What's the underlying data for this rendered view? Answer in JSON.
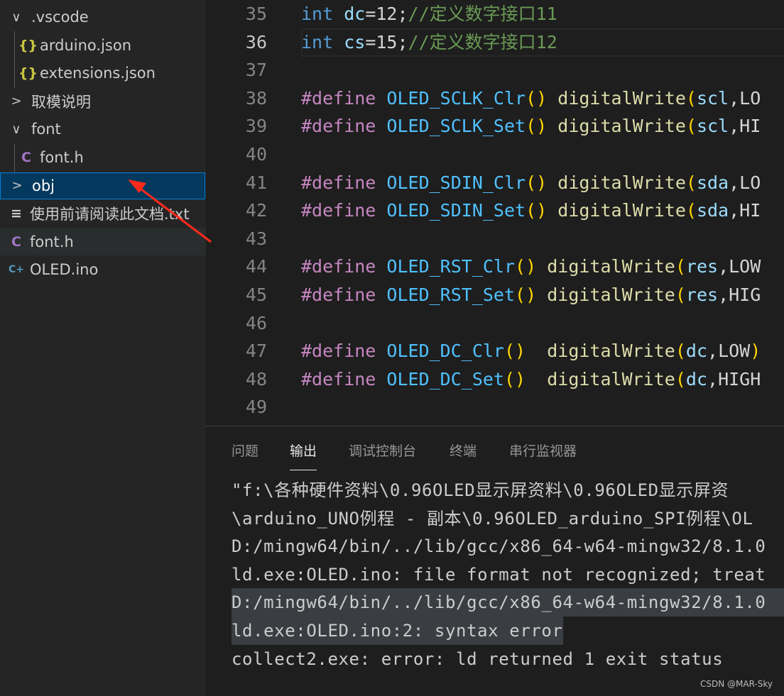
{
  "sidebar": {
    "items": [
      {
        "label": ".vscode",
        "icon": "chevron-down-icon",
        "twisty": "∨",
        "depth": 0
      },
      {
        "label": "arduino.json",
        "icon": "json-icon",
        "glyph": "{}",
        "color": "#cbcb41",
        "depth": 1
      },
      {
        "label": "extensions.json",
        "icon": "json-icon",
        "glyph": "{}",
        "color": "#cbcb41",
        "depth": 1
      },
      {
        "label": "取模说明",
        "icon": "chevron-right-icon",
        "twisty": ">",
        "depth": 0
      },
      {
        "label": "font",
        "icon": "chevron-down-icon",
        "twisty": "∨",
        "depth": 0
      },
      {
        "label": "font.h",
        "icon": "c-file-icon",
        "glyph": "C",
        "color": "#a074c4",
        "depth": 1
      },
      {
        "label": "obj",
        "icon": "chevron-right-icon",
        "twisty": ">",
        "depth": 0,
        "selected": true
      },
      {
        "label": "使用前请阅读此文档.txt",
        "icon": "text-file-icon",
        "glyph": "≡",
        "color": "#cccccc",
        "depth": 0
      },
      {
        "label": "font.h",
        "icon": "c-file-icon",
        "glyph": "C",
        "color": "#a074c4",
        "depth": 0,
        "hover": true
      },
      {
        "label": "OLED.ino",
        "icon": "cpp-file-icon",
        "glyph": "C+",
        "color": "#519aba",
        "depth": 0
      }
    ]
  },
  "editor": {
    "current_line": 36,
    "lines": [
      {
        "n": "35",
        "t": [
          [
            "kw",
            "int"
          ],
          [
            "tx",
            " "
          ],
          [
            "var",
            "dc"
          ],
          [
            "tx",
            "=12;"
          ],
          [
            "cm",
            "//定义数字接口11"
          ]
        ]
      },
      {
        "n": "36",
        "t": [
          [
            "kw",
            "int"
          ],
          [
            "tx",
            " "
          ],
          [
            "var",
            "cs"
          ],
          [
            "tx",
            "=15;"
          ],
          [
            "cm",
            "//定义数字接口12"
          ]
        ]
      },
      {
        "n": "37",
        "t": []
      },
      {
        "n": "38",
        "t": [
          [
            "pp",
            "#define"
          ],
          [
            "tx",
            " "
          ],
          [
            "mac",
            "OLED_SCLK_Clr"
          ],
          [
            "br",
            "()"
          ],
          [
            "tx",
            " "
          ],
          [
            "fn",
            "digitalWrite"
          ],
          [
            "br",
            "("
          ],
          [
            "var",
            "scl"
          ],
          [
            "tx",
            ",LO"
          ]
        ]
      },
      {
        "n": "39",
        "t": [
          [
            "pp",
            "#define"
          ],
          [
            "tx",
            " "
          ],
          [
            "mac",
            "OLED_SCLK_Set"
          ],
          [
            "br",
            "()"
          ],
          [
            "tx",
            " "
          ],
          [
            "fn",
            "digitalWrite"
          ],
          [
            "br",
            "("
          ],
          [
            "var",
            "scl"
          ],
          [
            "tx",
            ",HI"
          ]
        ]
      },
      {
        "n": "40",
        "t": []
      },
      {
        "n": "41",
        "t": [
          [
            "pp",
            "#define"
          ],
          [
            "tx",
            " "
          ],
          [
            "mac",
            "OLED_SDIN_Clr"
          ],
          [
            "br",
            "()"
          ],
          [
            "tx",
            " "
          ],
          [
            "fn",
            "digitalWrite"
          ],
          [
            "br",
            "("
          ],
          [
            "var",
            "sda"
          ],
          [
            "tx",
            ",LO"
          ]
        ]
      },
      {
        "n": "42",
        "t": [
          [
            "pp",
            "#define"
          ],
          [
            "tx",
            " "
          ],
          [
            "mac",
            "OLED_SDIN_Set"
          ],
          [
            "br",
            "()"
          ],
          [
            "tx",
            " "
          ],
          [
            "fn",
            "digitalWrite"
          ],
          [
            "br",
            "("
          ],
          [
            "var",
            "sda"
          ],
          [
            "tx",
            ",HI"
          ]
        ]
      },
      {
        "n": "43",
        "t": []
      },
      {
        "n": "44",
        "t": [
          [
            "pp",
            "#define"
          ],
          [
            "tx",
            " "
          ],
          [
            "mac",
            "OLED_RST_Clr"
          ],
          [
            "br",
            "()"
          ],
          [
            "tx",
            " "
          ],
          [
            "fn",
            "digitalWrite"
          ],
          [
            "br",
            "("
          ],
          [
            "var",
            "res"
          ],
          [
            "tx",
            ",LOW"
          ]
        ]
      },
      {
        "n": "45",
        "t": [
          [
            "pp",
            "#define"
          ],
          [
            "tx",
            " "
          ],
          [
            "mac",
            "OLED_RST_Set"
          ],
          [
            "br",
            "()"
          ],
          [
            "tx",
            " "
          ],
          [
            "fn",
            "digitalWrite"
          ],
          [
            "br",
            "("
          ],
          [
            "var",
            "res"
          ],
          [
            "tx",
            ",HIG"
          ]
        ]
      },
      {
        "n": "46",
        "t": []
      },
      {
        "n": "47",
        "t": [
          [
            "pp",
            "#define"
          ],
          [
            "tx",
            " "
          ],
          [
            "mac",
            "OLED_DC_Clr"
          ],
          [
            "br",
            "()"
          ],
          [
            "tx",
            "  "
          ],
          [
            "fn",
            "digitalWrite"
          ],
          [
            "br",
            "("
          ],
          [
            "var",
            "dc"
          ],
          [
            "tx",
            ",LOW"
          ],
          [
            "br",
            ")"
          ]
        ]
      },
      {
        "n": "48",
        "t": [
          [
            "pp",
            "#define"
          ],
          [
            "tx",
            " "
          ],
          [
            "mac",
            "OLED_DC_Set"
          ],
          [
            "br",
            "()"
          ],
          [
            "tx",
            "  "
          ],
          [
            "fn",
            "digitalWrite"
          ],
          [
            "br",
            "("
          ],
          [
            "var",
            "dc"
          ],
          [
            "tx",
            ",HIGH"
          ]
        ]
      },
      {
        "n": "49",
        "t": []
      }
    ]
  },
  "panel": {
    "tabs": [
      "问题",
      "输出",
      "调试控制台",
      "终端",
      "串行监视器"
    ],
    "active_tab": 1,
    "output": [
      "\"f:\\各种硬件资料\\0.96OLED显示屏资料\\0.96OLED显示屏资",
      "\\arduino_UNO例程 - 副本\\0.96OLED_arduino_SPI例程\\OL",
      "D:/mingw64/bin/../lib/gcc/x86_64-w64-mingw32/8.1.0",
      "ld.exe:OLED.ino: file format not recognized; treat",
      "D:/mingw64/bin/../lib/gcc/x86_64-w64-mingw32/8.1.0",
      "ld.exe:OLED.ino:2: syntax error",
      "collect2.exe: error: ld returned 1 exit status"
    ],
    "highlighted": [
      4,
      5
    ]
  },
  "watermark": "CSDN @MAR-Sky",
  "annotation": {
    "type": "red-arrow",
    "color": "#ff2a1a",
    "points_to": "obj"
  }
}
